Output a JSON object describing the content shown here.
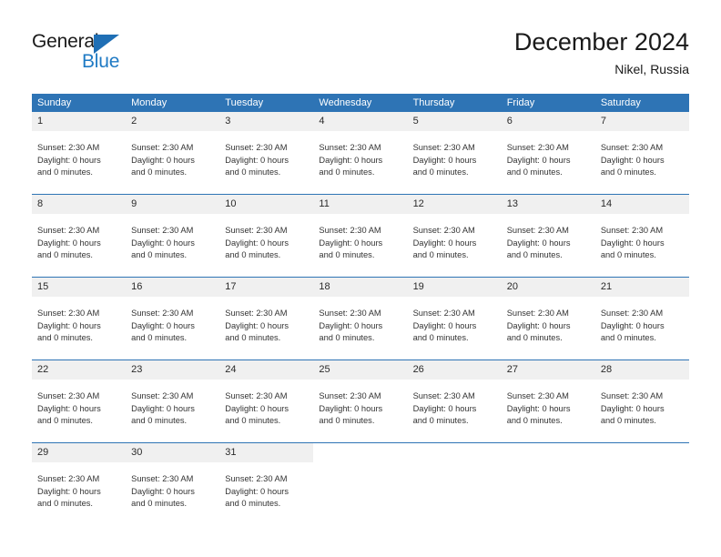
{
  "logo": {
    "word_top": "General",
    "word_bottom": "Blue",
    "triangle_icon": "blue-triangle-icon",
    "blue": "#1f7ac4"
  },
  "header": {
    "title": "December 2024",
    "subtitle": "Nikel, Russia"
  },
  "theme": {
    "header_blue": "#2e74b5",
    "daynum_band": "#f0f0f0",
    "text": "#333333"
  },
  "calendar": {
    "weekdays": [
      "Sunday",
      "Monday",
      "Tuesday",
      "Wednesday",
      "Thursday",
      "Friday",
      "Saturday"
    ],
    "event_lines": [
      "Sunset: 2:30 AM",
      "Daylight: 0 hours",
      "and 0 minutes."
    ],
    "weeks": [
      {
        "days": [
          {
            "num": "1",
            "lines": [
              "Sunset: 2:30 AM",
              "Daylight: 0 hours",
              "and 0 minutes."
            ]
          },
          {
            "num": "2",
            "lines": [
              "Sunset: 2:30 AM",
              "Daylight: 0 hours",
              "and 0 minutes."
            ]
          },
          {
            "num": "3",
            "lines": [
              "Sunset: 2:30 AM",
              "Daylight: 0 hours",
              "and 0 minutes."
            ]
          },
          {
            "num": "4",
            "lines": [
              "Sunset: 2:30 AM",
              "Daylight: 0 hours",
              "and 0 minutes."
            ]
          },
          {
            "num": "5",
            "lines": [
              "Sunset: 2:30 AM",
              "Daylight: 0 hours",
              "and 0 minutes."
            ]
          },
          {
            "num": "6",
            "lines": [
              "Sunset: 2:30 AM",
              "Daylight: 0 hours",
              "and 0 minutes."
            ]
          },
          {
            "num": "7",
            "lines": [
              "Sunset: 2:30 AM",
              "Daylight: 0 hours",
              "and 0 minutes."
            ]
          }
        ]
      },
      {
        "days": [
          {
            "num": "8",
            "lines": [
              "Sunset: 2:30 AM",
              "Daylight: 0 hours",
              "and 0 minutes."
            ]
          },
          {
            "num": "9",
            "lines": [
              "Sunset: 2:30 AM",
              "Daylight: 0 hours",
              "and 0 minutes."
            ]
          },
          {
            "num": "10",
            "lines": [
              "Sunset: 2:30 AM",
              "Daylight: 0 hours",
              "and 0 minutes."
            ]
          },
          {
            "num": "11",
            "lines": [
              "Sunset: 2:30 AM",
              "Daylight: 0 hours",
              "and 0 minutes."
            ]
          },
          {
            "num": "12",
            "lines": [
              "Sunset: 2:30 AM",
              "Daylight: 0 hours",
              "and 0 minutes."
            ]
          },
          {
            "num": "13",
            "lines": [
              "Sunset: 2:30 AM",
              "Daylight: 0 hours",
              "and 0 minutes."
            ]
          },
          {
            "num": "14",
            "lines": [
              "Sunset: 2:30 AM",
              "Daylight: 0 hours",
              "and 0 minutes."
            ]
          }
        ]
      },
      {
        "days": [
          {
            "num": "15",
            "lines": [
              "Sunset: 2:30 AM",
              "Daylight: 0 hours",
              "and 0 minutes."
            ]
          },
          {
            "num": "16",
            "lines": [
              "Sunset: 2:30 AM",
              "Daylight: 0 hours",
              "and 0 minutes."
            ]
          },
          {
            "num": "17",
            "lines": [
              "Sunset: 2:30 AM",
              "Daylight: 0 hours",
              "and 0 minutes."
            ]
          },
          {
            "num": "18",
            "lines": [
              "Sunset: 2:30 AM",
              "Daylight: 0 hours",
              "and 0 minutes."
            ]
          },
          {
            "num": "19",
            "lines": [
              "Sunset: 2:30 AM",
              "Daylight: 0 hours",
              "and 0 minutes."
            ]
          },
          {
            "num": "20",
            "lines": [
              "Sunset: 2:30 AM",
              "Daylight: 0 hours",
              "and 0 minutes."
            ]
          },
          {
            "num": "21",
            "lines": [
              "Sunset: 2:30 AM",
              "Daylight: 0 hours",
              "and 0 minutes."
            ]
          }
        ]
      },
      {
        "days": [
          {
            "num": "22",
            "lines": [
              "Sunset: 2:30 AM",
              "Daylight: 0 hours",
              "and 0 minutes."
            ]
          },
          {
            "num": "23",
            "lines": [
              "Sunset: 2:30 AM",
              "Daylight: 0 hours",
              "and 0 minutes."
            ]
          },
          {
            "num": "24",
            "lines": [
              "Sunset: 2:30 AM",
              "Daylight: 0 hours",
              "and 0 minutes."
            ]
          },
          {
            "num": "25",
            "lines": [
              "Sunset: 2:30 AM",
              "Daylight: 0 hours",
              "and 0 minutes."
            ]
          },
          {
            "num": "26",
            "lines": [
              "Sunset: 2:30 AM",
              "Daylight: 0 hours",
              "and 0 minutes."
            ]
          },
          {
            "num": "27",
            "lines": [
              "Sunset: 2:30 AM",
              "Daylight: 0 hours",
              "and 0 minutes."
            ]
          },
          {
            "num": "28",
            "lines": [
              "Sunset: 2:30 AM",
              "Daylight: 0 hours",
              "and 0 minutes."
            ]
          }
        ]
      },
      {
        "days": [
          {
            "num": "29",
            "lines": [
              "Sunset: 2:30 AM",
              "Daylight: 0 hours",
              "and 0 minutes."
            ]
          },
          {
            "num": "30",
            "lines": [
              "Sunset: 2:30 AM",
              "Daylight: 0 hours",
              "and 0 minutes."
            ]
          },
          {
            "num": "31",
            "lines": [
              "Sunset: 2:30 AM",
              "Daylight: 0 hours",
              "and 0 minutes."
            ]
          },
          {
            "num": "",
            "lines": []
          },
          {
            "num": "",
            "lines": []
          },
          {
            "num": "",
            "lines": []
          },
          {
            "num": "",
            "lines": []
          }
        ]
      }
    ]
  }
}
